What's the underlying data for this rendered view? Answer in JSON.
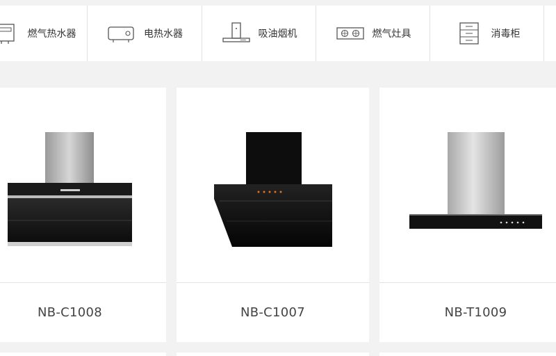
{
  "categories": [
    {
      "label": "燃气热水器",
      "icon": "gas-water-heater-icon"
    },
    {
      "label": "电热水器",
      "icon": "electric-water-heater-icon"
    },
    {
      "label": "吸油烟机",
      "icon": "range-hood-icon"
    },
    {
      "label": "燃气灶具",
      "icon": "gas-stove-icon"
    },
    {
      "label": "消毒柜",
      "icon": "disinfection-cabinet-icon"
    }
  ],
  "products": [
    {
      "model": "NB-C1008",
      "image": "side-draft-range-hood-image"
    },
    {
      "model": "NB-C1007",
      "image": "black-glass-range-hood-image"
    },
    {
      "model": "NB-T1009",
      "image": "t-shaped-range-hood-image"
    }
  ],
  "colors": {
    "background": "#f2f2f2",
    "card": "#ffffff",
    "divider": "#e2e2e2",
    "text": "#444444"
  }
}
